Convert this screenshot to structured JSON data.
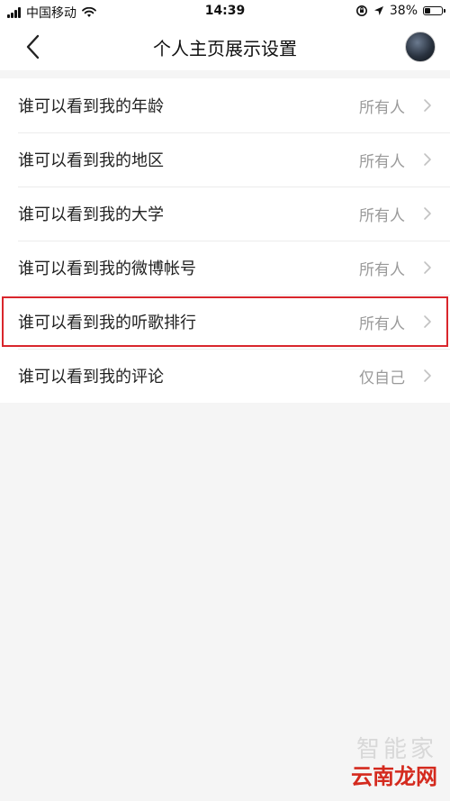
{
  "status_bar": {
    "carrier": "中国移动",
    "time": "14:39",
    "battery_percent": "38%",
    "battery_level": 0.38,
    "icons": [
      "signal-icon",
      "wifi-icon",
      "orientation-lock-icon",
      "location-icon",
      "battery-icon"
    ]
  },
  "header": {
    "title": "个人主页展示设置",
    "back_icon": "chevron-left-icon",
    "avatar_icon": "avatar"
  },
  "settings": [
    {
      "label": "谁可以看到我的年龄",
      "value": "所有人"
    },
    {
      "label": "谁可以看到我的地区",
      "value": "所有人"
    },
    {
      "label": "谁可以看到我的大学",
      "value": "所有人"
    },
    {
      "label": "谁可以看到我的微博帐号",
      "value": "所有人"
    },
    {
      "label": "谁可以看到我的听歌排行",
      "value": "所有人"
    },
    {
      "label": "谁可以看到我的评论",
      "value": "仅自己"
    }
  ],
  "highlight": {
    "row_index": 4,
    "color": "#d9262c"
  },
  "watermark": {
    "top": "智能家",
    "bottom": "云南龙网"
  },
  "colors": {
    "background": "#f5f5f5",
    "value_text": "#9a9a9a",
    "watermark_red": "#d42a1e"
  }
}
